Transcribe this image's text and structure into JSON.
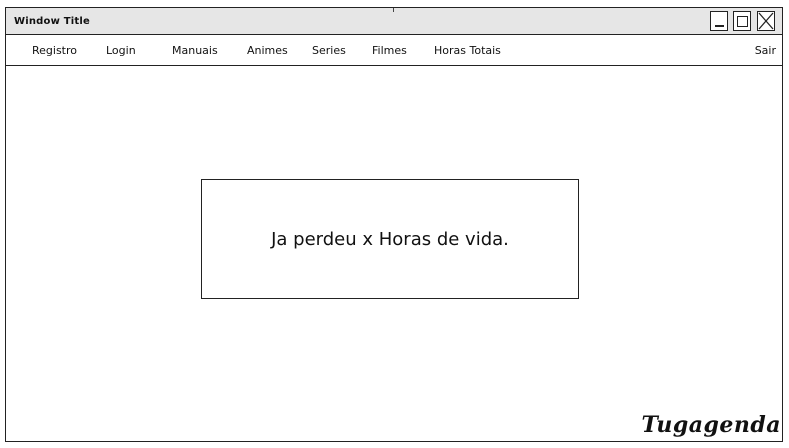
{
  "window": {
    "title": "Window Title"
  },
  "window_controls": {
    "minimize_icon": "minimize-icon",
    "maximize_icon": "maximize-icon",
    "close_icon": "close-icon"
  },
  "menu": {
    "items": [
      "Registro",
      "Login",
      "Manuais",
      "Animes",
      "Series",
      "Filmes",
      "Horas Totais"
    ],
    "logout_label": "Sair"
  },
  "main": {
    "message": "Ja perdeu x Horas de vida."
  },
  "brand": {
    "name": "Tugagenda"
  }
}
